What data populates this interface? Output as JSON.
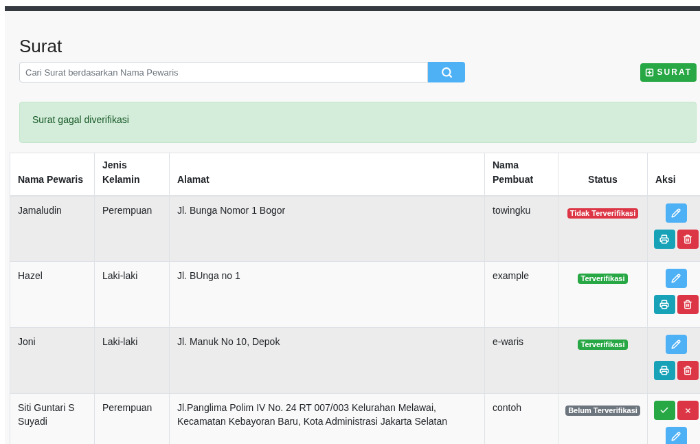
{
  "page": {
    "title": "Surat"
  },
  "search": {
    "placeholder": "Cari Surat berdasarkan Nama Pewaris"
  },
  "add_button": {
    "label": "SURAT"
  },
  "alert": {
    "text": "Surat gagal diverifikasi"
  },
  "table": {
    "columns": [
      "Nama Pewaris",
      "Jenis Kelamin",
      "Alamat",
      "Nama Pembuat",
      "Status",
      "Aksi"
    ],
    "rows": [
      {
        "cells": [
          "Jamaludin",
          "Perempuan",
          "Jl. Bunga Nomor 1 Bogor",
          "towingku"
        ],
        "status": {
          "label": "Tidak Terverifikasi",
          "kind": "danger"
        },
        "actions": [
          {
            "kind": "edit"
          },
          {
            "kind": "print"
          },
          {
            "kind": "delete"
          }
        ]
      },
      {
        "cells": [
          "Hazel",
          "Laki-laki",
          "Jl. BUnga no 1",
          "example"
        ],
        "status": {
          "label": "Terverifikasi",
          "kind": "success"
        },
        "actions": [
          {
            "kind": "edit"
          },
          {
            "kind": "print"
          },
          {
            "kind": "delete"
          }
        ]
      },
      {
        "cells": [
          "Joni",
          "Laki-laki",
          "Jl. Manuk No 10, Depok",
          "e-waris"
        ],
        "status": {
          "label": "Terverifikasi",
          "kind": "success"
        },
        "actions": [
          {
            "kind": "edit"
          },
          {
            "kind": "print"
          },
          {
            "kind": "delete"
          }
        ]
      },
      {
        "cells": [
          "Siti Guntari S Suyadi",
          "Perempuan",
          "Jl.Panglima Polim IV No. 24 RT 007/003 Kelurahan Melawai, Kecamatan Kebayoran Baru, Kota Administrasi Jakarta Selatan",
          "contoh"
        ],
        "status": {
          "label": "Belum Terverifikasi",
          "kind": "secondary"
        },
        "actions": [
          {
            "kind": "approve"
          },
          {
            "kind": "reject"
          },
          {
            "kind": "edit"
          }
        ]
      }
    ]
  }
}
